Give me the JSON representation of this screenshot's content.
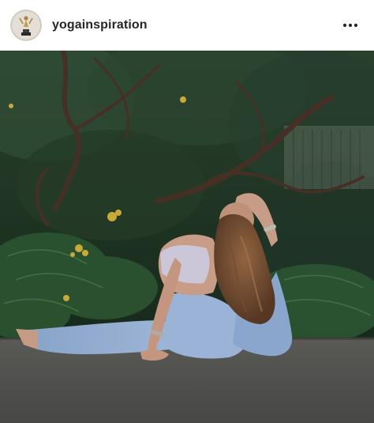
{
  "post": {
    "username": "yogainspiration",
    "avatar_icon": "yoga-pose-avatar-icon",
    "more_icon": "more-options-icon"
  },
  "photo": {
    "subject": "yoga-mermaid-pose-photo"
  },
  "colors": {
    "username_text": "#262626",
    "foliage_dark": "#1f3323",
    "legging_blue": "#9db7dc",
    "ground": "#5a5a58"
  }
}
